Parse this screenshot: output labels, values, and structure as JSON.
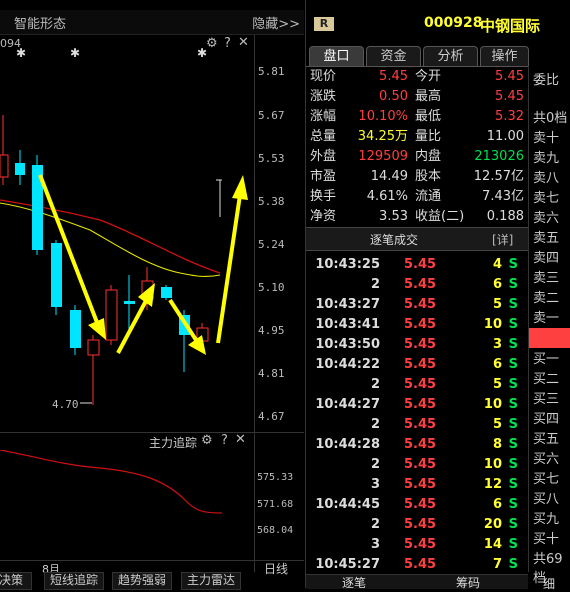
{
  "chart": {
    "title": "智能形态",
    "hide_label": "隐藏>>",
    "partial_code": "094",
    "price_ticks": [
      "5.81",
      "5.67",
      "5.53",
      "5.38",
      "5.24",
      "5.10",
      "4.95",
      "4.81",
      "4.67"
    ],
    "low_label": "4.70",
    "indicator_title": "主力追踪",
    "indicator_ticks": [
      "575.33",
      "571.68",
      "568.04"
    ],
    "month_label": "8月",
    "daily_line": "日线",
    "bottom_tabs": [
      "决策",
      "短线追踪",
      "趋势强弱",
      "主力雷达"
    ],
    "colors": {
      "up": "#ff3030",
      "down": "#00e5ff",
      "ma_yellow": "#e8e800",
      "ma_red": "#d01010",
      "arrow": "#ffff00"
    }
  },
  "quote": {
    "badge": "R",
    "code": "000928",
    "name": "中钢国际",
    "tabs": [
      "盘口",
      "资金",
      "分析",
      "操作"
    ],
    "rows": [
      {
        "l1": "现价",
        "v1": "5.45",
        "c1": "red",
        "l2": "今开",
        "v2": "5.45",
        "c2": "red"
      },
      {
        "l1": "涨跌",
        "v1": "0.50",
        "c1": "red",
        "l2": "最高",
        "v2": "5.45",
        "c2": "red"
      },
      {
        "l1": "涨幅",
        "v1": "10.10%",
        "c1": "red",
        "l2": "最低",
        "v2": "5.32",
        "c2": "red"
      },
      {
        "l1": "总量",
        "v1": "34.25万",
        "c1": "yellow",
        "l2": "量比",
        "v2": "11.00",
        "c2": "white"
      },
      {
        "l1": "外盘",
        "v1": "129509",
        "c1": "red",
        "l2": "内盘",
        "v2": "213026",
        "c2": "green"
      },
      {
        "l1": "市盈",
        "v1": "14.49",
        "c1": "white",
        "l2": "股本",
        "v2": "12.57亿",
        "c2": "white"
      },
      {
        "l1": "换手",
        "v1": "4.61%",
        "c1": "white",
        "l2": "流通",
        "v2": "7.43亿",
        "c2": "white"
      },
      {
        "l1": "净资",
        "v1": "3.53",
        "c1": "white",
        "l2": "收益(二)",
        "v2": "0.188",
        "c2": "white"
      }
    ],
    "trades_title": "逐笔成交",
    "trades_detail": "[详]",
    "trades": [
      {
        "time": "10:43:25",
        "price": "5.45",
        "vol": "4",
        "dir": "S"
      },
      {
        "time": "2",
        "price": "5.45",
        "vol": "6",
        "dir": "S"
      },
      {
        "time": "10:43:27",
        "price": "5.45",
        "vol": "5",
        "dir": "S"
      },
      {
        "time": "10:43:41",
        "price": "5.45",
        "vol": "10",
        "dir": "S"
      },
      {
        "time": "10:43:50",
        "price": "5.45",
        "vol": "3",
        "dir": "S"
      },
      {
        "time": "10:44:22",
        "price": "5.45",
        "vol": "6",
        "dir": "S"
      },
      {
        "time": "2",
        "price": "5.45",
        "vol": "5",
        "dir": "S"
      },
      {
        "time": "10:44:27",
        "price": "5.45",
        "vol": "10",
        "dir": "S"
      },
      {
        "time": "2",
        "price": "5.45",
        "vol": "5",
        "dir": "S"
      },
      {
        "time": "10:44:28",
        "price": "5.45",
        "vol": "8",
        "dir": "S"
      },
      {
        "time": "2",
        "price": "5.45",
        "vol": "10",
        "dir": "S"
      },
      {
        "time": "3",
        "price": "5.45",
        "vol": "12",
        "dir": "S"
      },
      {
        "time": "10:44:45",
        "price": "5.45",
        "vol": "6",
        "dir": "S"
      },
      {
        "time": "2",
        "price": "5.45",
        "vol": "20",
        "dir": "S"
      },
      {
        "time": "3",
        "price": "5.45",
        "vol": "14",
        "dir": "S"
      },
      {
        "time": "10:45:27",
        "price": "5.45",
        "vol": "7",
        "dir": "S"
      }
    ],
    "bottom_tabs": [
      "逐笔",
      "筹码"
    ],
    "side": {
      "ratio_label": "委比",
      "sell_count": "共0档",
      "sells": [
        "卖十",
        "卖九",
        "卖八",
        "卖七",
        "卖六",
        "卖五",
        "卖四",
        "卖三",
        "卖二",
        "卖一"
      ],
      "buys": [
        "买一",
        "买二",
        "买三",
        "买四",
        "买五",
        "买六",
        "买七",
        "买八",
        "买九",
        "买十"
      ],
      "buy_count": "共69档",
      "bottom_tab": "细"
    }
  }
}
